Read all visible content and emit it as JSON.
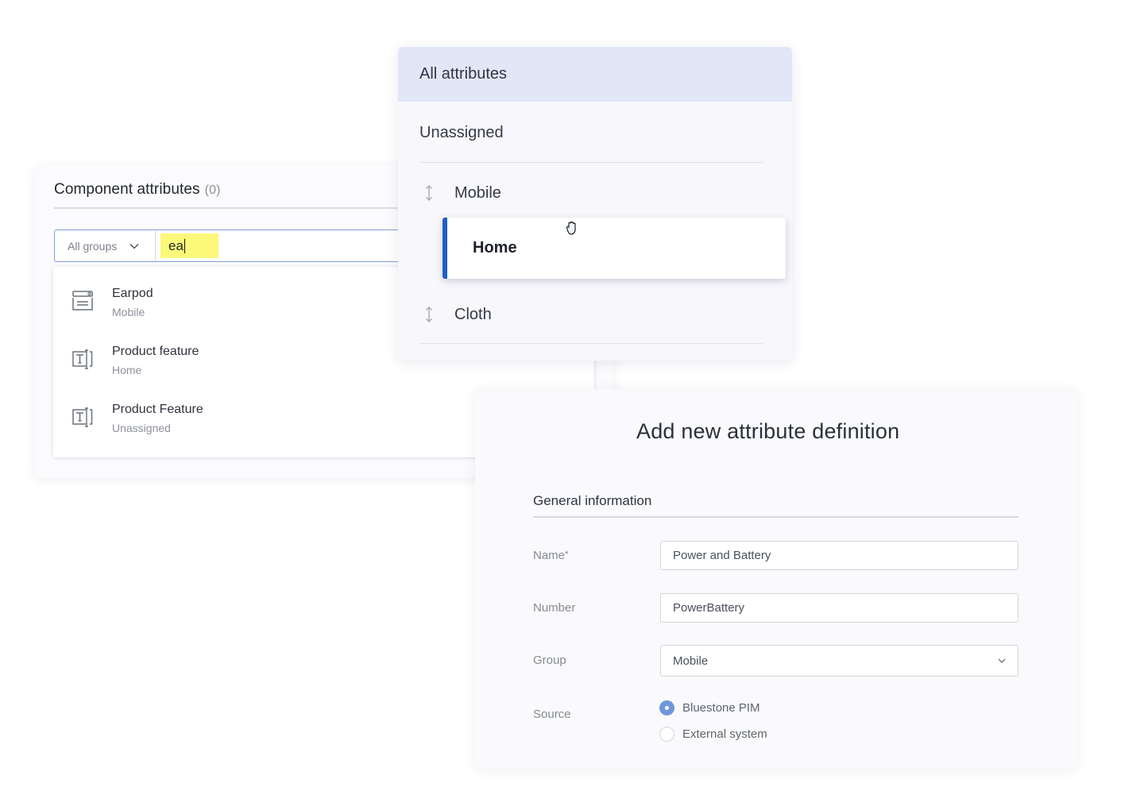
{
  "component_attributes": {
    "title": "Component attributes",
    "count": "(0)",
    "group_filter": {
      "selected": "All groups"
    },
    "search": {
      "value": "ea"
    },
    "results": [
      {
        "name": "Earpod",
        "group": "Mobile",
        "icon": "list-attribute-icon"
      },
      {
        "name": "Product feature",
        "group": "Home",
        "icon": "text-attribute-icon"
      },
      {
        "name": "Product Feature",
        "group": "Unassigned",
        "icon": "text-attribute-icon"
      }
    ]
  },
  "attribute_groups": {
    "all": "All attributes",
    "unassigned": "Unassigned",
    "groups": [
      {
        "label": "Mobile"
      },
      {
        "label": "Home",
        "dragging": true
      },
      {
        "label": "Cloth"
      }
    ],
    "accent_color": "#1f5fc6",
    "selected_bg": "#e1e7f7"
  },
  "attribute_definition": {
    "title": "Add new attribute definition",
    "section": "General information",
    "fields": {
      "name": {
        "label": "Name",
        "required_mark": "*",
        "value": "Power and Battery"
      },
      "number": {
        "label": "Number",
        "value": "PowerBattery"
      },
      "group": {
        "label": "Group",
        "value": "Mobile"
      },
      "source": {
        "label": "Source",
        "options": [
          {
            "label": "Bluestone PIM",
            "selected": true
          },
          {
            "label": "External system",
            "selected": false
          }
        ]
      }
    },
    "radio_color": "#6f95dc"
  }
}
